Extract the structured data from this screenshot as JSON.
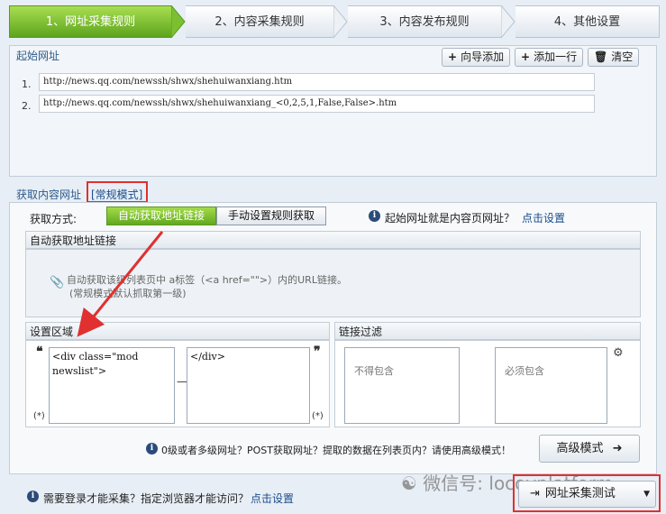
{
  "steps": [
    {
      "label": "1、网址采集规则",
      "active": true
    },
    {
      "label": "2、内容采集规则",
      "active": false
    },
    {
      "label": "3、内容发布规则",
      "active": false
    },
    {
      "label": "4、其他设置",
      "active": false
    }
  ],
  "start_urls": {
    "title": "起始网址",
    "buttons": {
      "wizard_add": "向导添加",
      "add_row": "添加一行",
      "clear": "清空"
    },
    "rows": [
      {
        "num": "1.",
        "url": "http://news.qq.com/newssh/shwx/shehuiwanxiang.htm"
      },
      {
        "num": "2.",
        "url": "http://news.qq.com/newssh/shwx/shehuiwanxiang_<0,2,5,1,False,False>.htm"
      }
    ]
  },
  "content_urls": {
    "title": "获取内容网址",
    "mode_label": "[常规模式]",
    "method_label": "获取方式:",
    "method_auto": "自动获取地址链接",
    "method_manual": "手动设置规则获取",
    "start_is_content_text": "起始网址就是内容页网址？",
    "start_is_content_link": "点击设置"
  },
  "auto_links": {
    "header": "自动获取地址链接",
    "desc_line1": "自动获取该级列表页中 a标签（<a href=\"\">）内的URL链接。",
    "desc_line2": "(常规模式默认抓取第一级)"
  },
  "settings_area": {
    "header": "设置区域",
    "start_code": "<div class=\"mod\nnewslist\">",
    "end_code": "</div>",
    "open_quote": "❝",
    "close_quote": "❞",
    "wildcard": "(*)",
    "dash": "—"
  },
  "link_filter": {
    "header": "链接过滤",
    "exclude_placeholder": "不得包含",
    "include_placeholder": "必须包含"
  },
  "advanced": {
    "hint": "0级或者多级网址？POST获取网址？提取的数据在列表页内？请使用高级模式！",
    "button": "高级模式"
  },
  "footer": {
    "login_text": "需要登录才能采集？指定浏览器才能访问？",
    "login_link": "点击设置",
    "test_button": "网址采集测试",
    "watermark": "微信号: locoyplatform"
  },
  "colors": {
    "accent_green": "#62a81f",
    "link_blue": "#1a4c8c",
    "highlight_red": "#e03030"
  }
}
